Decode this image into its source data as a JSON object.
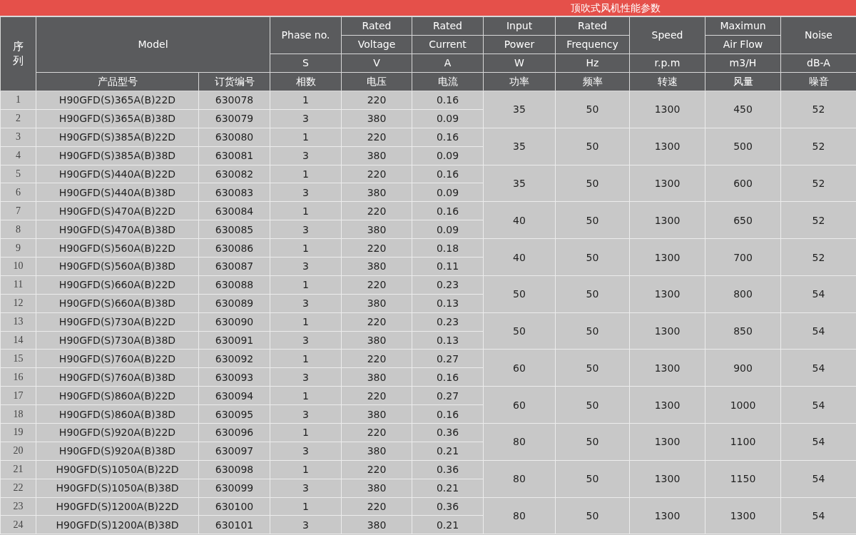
{
  "title": "顶吹式风机性能参数",
  "header": {
    "seq_label": "序列",
    "model_label": "Model",
    "model_cn": [
      "产品型号",
      "订货编号"
    ],
    "columns": [
      {
        "lines": [
          "Phase no."
        ],
        "unit": "S",
        "cn": "相数"
      },
      {
        "lines": [
          "Rated",
          "Voltage"
        ],
        "unit": "V",
        "cn": "电压"
      },
      {
        "lines": [
          "Rated",
          "Current"
        ],
        "unit": "A",
        "cn": "电流"
      },
      {
        "lines": [
          "Input",
          "Power"
        ],
        "unit": "W",
        "cn": "功率"
      },
      {
        "lines": [
          "Rated",
          "Frequency"
        ],
        "unit": "Hz",
        "cn": "频率"
      },
      {
        "lines": [
          "Speed"
        ],
        "unit": "r.p.m",
        "cn": "转速"
      },
      {
        "lines": [
          "Maximun",
          "Air Flow"
        ],
        "unit": "m3/H",
        "cn": "风量"
      },
      {
        "lines": [
          "Noise"
        ],
        "unit": "dB-A",
        "cn": "噪音"
      }
    ]
  },
  "groups": [
    {
      "power": "35",
      "frequency": "50",
      "speed": "1300",
      "airflow": "450",
      "noise": "52",
      "rows": [
        {
          "seq": "1",
          "model": "H90GFD(S)365A(B)22D",
          "order_no": "630078",
          "phase": "1",
          "voltage": "220",
          "current": "0.16"
        },
        {
          "seq": "2",
          "model": "H90GFD(S)365A(B)38D",
          "order_no": "630079",
          "phase": "3",
          "voltage": "380",
          "current": "0.09"
        }
      ]
    },
    {
      "power": "35",
      "frequency": "50",
      "speed": "1300",
      "airflow": "500",
      "noise": "52",
      "rows": [
        {
          "seq": "3",
          "model": "H90GFD(S)385A(B)22D",
          "order_no": "630080",
          "phase": "1",
          "voltage": "220",
          "current": "0.16"
        },
        {
          "seq": "4",
          "model": "H90GFD(S)385A(B)38D",
          "order_no": "630081",
          "phase": "3",
          "voltage": "380",
          "current": "0.09"
        }
      ]
    },
    {
      "power": "35",
      "frequency": "50",
      "speed": "1300",
      "airflow": "600",
      "noise": "52",
      "rows": [
        {
          "seq": "5",
          "model": "H90GFD(S)440A(B)22D",
          "order_no": "630082",
          "phase": "1",
          "voltage": "220",
          "current": "0.16"
        },
        {
          "seq": "6",
          "model": "H90GFD(S)440A(B)38D",
          "order_no": "630083",
          "phase": "3",
          "voltage": "380",
          "current": "0.09"
        }
      ]
    },
    {
      "power": "40",
      "frequency": "50",
      "speed": "1300",
      "airflow": "650",
      "noise": "52",
      "rows": [
        {
          "seq": "7",
          "model": "H90GFD(S)470A(B)22D",
          "order_no": "630084",
          "phase": "1",
          "voltage": "220",
          "current": "0.16"
        },
        {
          "seq": "8",
          "model": "H90GFD(S)470A(B)38D",
          "order_no": "630085",
          "phase": "3",
          "voltage": "380",
          "current": "0.09"
        }
      ]
    },
    {
      "power": "40",
      "frequency": "50",
      "speed": "1300",
      "airflow": "700",
      "noise": "52",
      "rows": [
        {
          "seq": "9",
          "model": "H90GFD(S)560A(B)22D",
          "order_no": "630086",
          "phase": "1",
          "voltage": "220",
          "current": "0.18"
        },
        {
          "seq": "10",
          "model": "H90GFD(S)560A(B)38D",
          "order_no": "630087",
          "phase": "3",
          "voltage": "380",
          "current": "0.11"
        }
      ]
    },
    {
      "power": "50",
      "frequency": "50",
      "speed": "1300",
      "airflow": "800",
      "noise": "54",
      "rows": [
        {
          "seq": "11",
          "model": "H90GFD(S)660A(B)22D",
          "order_no": "630088",
          "phase": "1",
          "voltage": "220",
          "current": "0.23"
        },
        {
          "seq": "12",
          "model": "H90GFD(S)660A(B)38D",
          "order_no": "630089",
          "phase": "3",
          "voltage": "380",
          "current": "0.13"
        }
      ]
    },
    {
      "power": "50",
      "frequency": "50",
      "speed": "1300",
      "airflow": "850",
      "noise": "54",
      "rows": [
        {
          "seq": "13",
          "model": "H90GFD(S)730A(B)22D",
          "order_no": "630090",
          "phase": "1",
          "voltage": "220",
          "current": "0.23"
        },
        {
          "seq": "14",
          "model": "H90GFD(S)730A(B)38D",
          "order_no": "630091",
          "phase": "3",
          "voltage": "380",
          "current": "0.13"
        }
      ]
    },
    {
      "power": "60",
      "frequency": "50",
      "speed": "1300",
      "airflow": "900",
      "noise": "54",
      "rows": [
        {
          "seq": "15",
          "model": "H90GFD(S)760A(B)22D",
          "order_no": "630092",
          "phase": "1",
          "voltage": "220",
          "current": "0.27"
        },
        {
          "seq": "16",
          "model": "H90GFD(S)760A(B)38D",
          "order_no": "630093",
          "phase": "3",
          "voltage": "380",
          "current": "0.16"
        }
      ]
    },
    {
      "power": "60",
      "frequency": "50",
      "speed": "1300",
      "airflow": "1000",
      "noise": "54",
      "rows": [
        {
          "seq": "17",
          "model": "H90GFD(S)860A(B)22D",
          "order_no": "630094",
          "phase": "1",
          "voltage": "220",
          "current": "0.27"
        },
        {
          "seq": "18",
          "model": "H90GFD(S)860A(B)38D",
          "order_no": "630095",
          "phase": "3",
          "voltage": "380",
          "current": "0.16"
        }
      ]
    },
    {
      "power": "80",
      "frequency": "50",
      "speed": "1300",
      "airflow": "1100",
      "noise": "54",
      "rows": [
        {
          "seq": "19",
          "model": "H90GFD(S)920A(B)22D",
          "order_no": "630096",
          "phase": "1",
          "voltage": "220",
          "current": "0.36"
        },
        {
          "seq": "20",
          "model": "H90GFD(S)920A(B)38D",
          "order_no": "630097",
          "phase": "3",
          "voltage": "380",
          "current": "0.21"
        }
      ]
    },
    {
      "power": "80",
      "frequency": "50",
      "speed": "1300",
      "airflow": "1150",
      "noise": "54",
      "rows": [
        {
          "seq": "21",
          "model": "H90GFD(S)1050A(B)22D",
          "order_no": "630098",
          "phase": "1",
          "voltage": "220",
          "current": "0.36"
        },
        {
          "seq": "22",
          "model": "H90GFD(S)1050A(B)38D",
          "order_no": "630099",
          "phase": "3",
          "voltage": "380",
          "current": "0.21"
        }
      ]
    },
    {
      "power": "80",
      "frequency": "50",
      "speed": "1300",
      "airflow": "1300",
      "noise": "54",
      "rows": [
        {
          "seq": "23",
          "model": "H90GFD(S)1200A(B)22D",
          "order_no": "630100",
          "phase": "1",
          "voltage": "220",
          "current": "0.36"
        },
        {
          "seq": "24",
          "model": "H90GFD(S)1200A(B)38D",
          "order_no": "630101",
          "phase": "3",
          "voltage": "380",
          "current": "0.21"
        }
      ]
    }
  ]
}
